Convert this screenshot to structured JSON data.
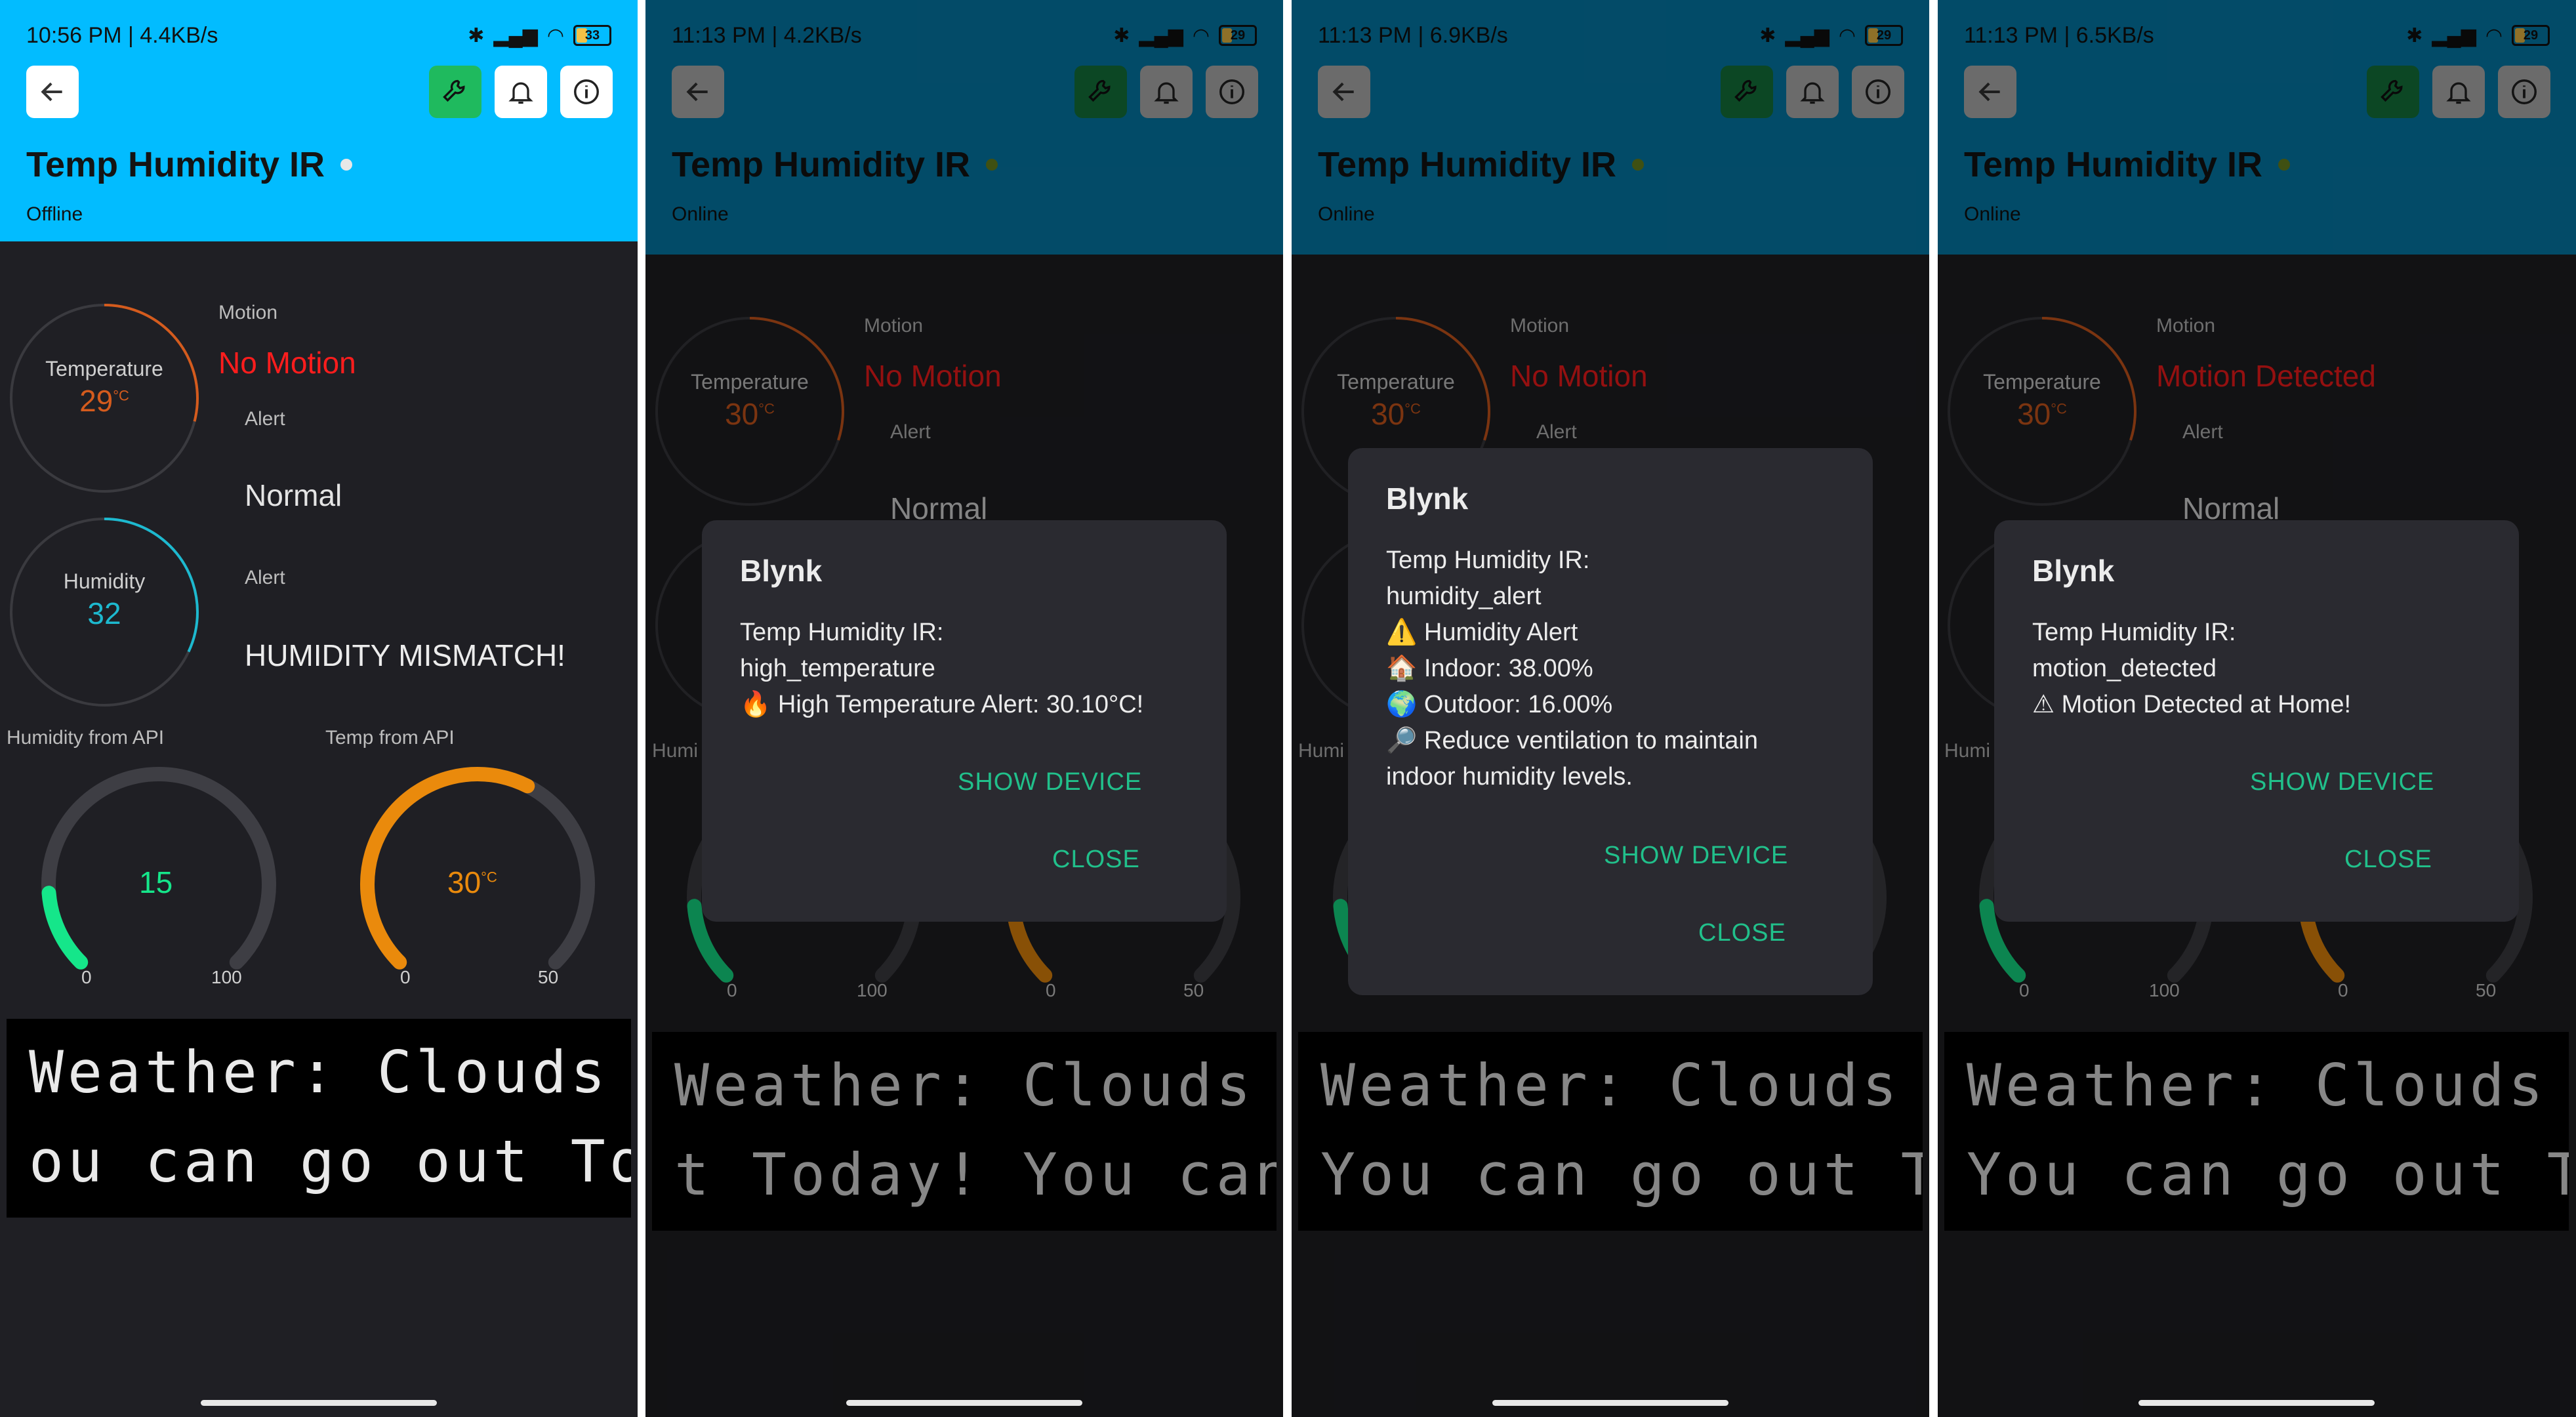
{
  "colors": {
    "header_bright": "#02bcff",
    "header_dim": "#0581b3",
    "panel_bg": "#1f1f24",
    "accent_green": "#21c08b",
    "temp_orange": "#d45b1d",
    "humidity_cyan": "#1db9cf",
    "gauge_green": "#15e68a",
    "gauge_orange": "#ea8a0c",
    "alert_red": "#ff1d1d",
    "wrench_green": "#1fba5e"
  },
  "app": {
    "device_name": "Temp Humidity IR",
    "icons": {
      "back": "back-arrow-icon",
      "wrench": "wrench-icon",
      "bell": "bell-icon",
      "info": "info-icon"
    }
  },
  "widgets": {
    "motion_label": "Motion",
    "temperature_label": "Temperature",
    "temperature_unit": "°C",
    "alert_label": "Alert",
    "humidity_label": "Humidity",
    "humidity_api_label": "Humidity from API",
    "temp_api_label": "Temp from API",
    "gauge_humidity": {
      "min": "0",
      "max": "100"
    },
    "gauge_temp": {
      "min": "0",
      "max": "50"
    }
  },
  "panels": [
    {
      "status_time": "10:56 PM | 4.4KB/s",
      "battery": "33",
      "connection": "Offline",
      "temperature": "29",
      "temperature_fraction": 0.29,
      "motion": "No Motion",
      "alert1": "Normal",
      "humidity": "32",
      "humidity_fraction": 0.32,
      "alert2": "HUMIDITY MISMATCH!",
      "humidity_api": "15",
      "humidity_api_fraction": 0.15,
      "temp_api": "30",
      "temp_api_fraction": 0.6,
      "lcd_line1": "Weather: Clouds",
      "lcd_line2": "ou can go out To"
    },
    {
      "status_time": "11:13 PM | 4.2KB/s",
      "battery": "29",
      "connection": "Online",
      "temperature": "30",
      "temperature_fraction": 0.3,
      "motion": "No Motion",
      "alert1": "Normal",
      "humidity_fraction": 0.32,
      "humidity_api_fraction": 0.15,
      "temp_api_fraction": 0.6,
      "humidity_partial_label": "Humi",
      "lcd_line1": "Weather: Clouds",
      "lcd_line2": "t Today! You can",
      "dialog": {
        "title": "Blynk",
        "lines": [
          "Temp Humidity IR:",
          "high_temperature",
          "🔥 High Temperature Alert: 30.10°C!"
        ],
        "show_device": "SHOW DEVICE",
        "close": "CLOSE"
      }
    },
    {
      "status_time": "11:13 PM | 6.9KB/s",
      "battery": "29",
      "connection": "Online",
      "temperature": "30",
      "temperature_fraction": 0.3,
      "motion": "No Motion",
      "alert1": "Normal",
      "humidity_fraction": 0.32,
      "humidity_api_fraction": 0.15,
      "temp_api_fraction": 0.6,
      "humidity_partial_label": "Humi",
      "lcd_line1": "Weather: Clouds",
      "lcd_line2": "You can go out T",
      "dialog": {
        "title": "Blynk",
        "lines": [
          "Temp Humidity IR:",
          "humidity_alert",
          "⚠️ Humidity Alert",
          "🏠 Indoor: 38.00%",
          "🌍 Outdoor: 16.00%",
          "🔎 Reduce ventilation to maintain",
          "indoor humidity levels."
        ],
        "show_device": "SHOW DEVICE",
        "close": "CLOSE"
      }
    },
    {
      "status_time": "11:13 PM | 6.5KB/s",
      "battery": "29",
      "connection": "Online",
      "temperature": "30",
      "temperature_fraction": 0.3,
      "motion": "Motion Detected",
      "alert1": "Normal",
      "humidity_fraction": 0.32,
      "humidity_api_fraction": 0.15,
      "temp_api_fraction": 0.6,
      "humidity_partial_label": "Humi",
      "lcd_line1": "Weather: Clouds",
      "lcd_line2": "You can go out T",
      "dialog": {
        "title": "Blynk",
        "lines": [
          "Temp Humidity IR:",
          "motion_detected",
          "⚠ Motion Detected at Home!"
        ],
        "show_device": "SHOW DEVICE",
        "close": "CLOSE"
      }
    }
  ]
}
